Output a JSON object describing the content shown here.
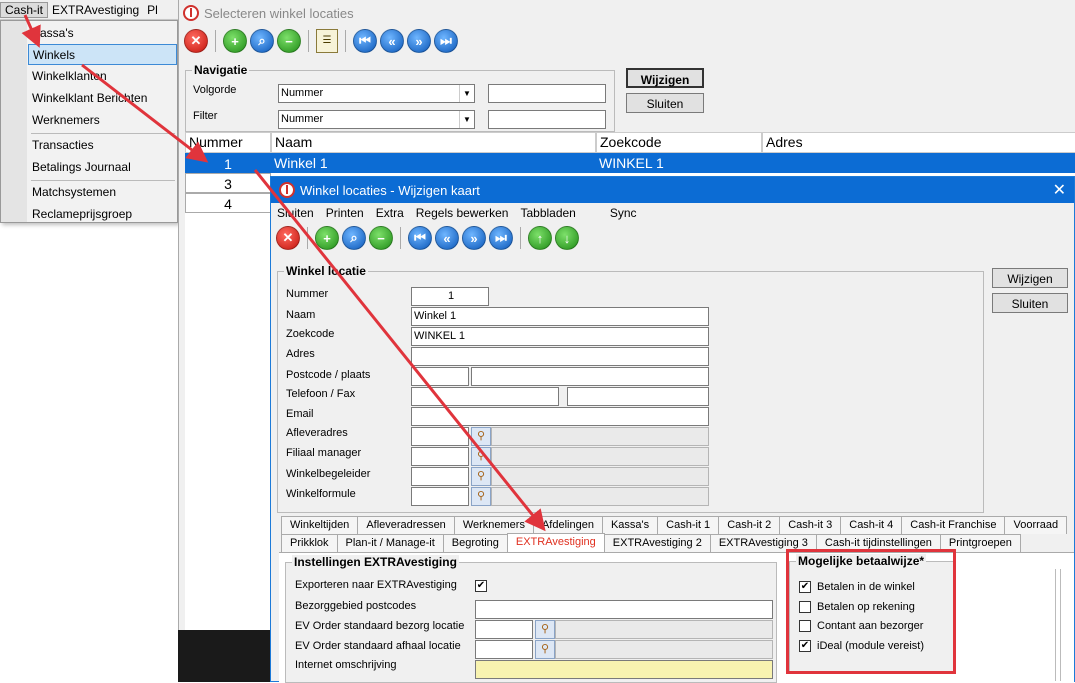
{
  "menubar": {
    "items": [
      "Cash-it",
      "EXTRAvestiging",
      "Pl"
    ]
  },
  "dropdown": {
    "items": [
      "Kassa's",
      "Winkels",
      "Winkelklanten",
      "Winkelklant Berichten",
      "Werknemers",
      "Transacties",
      "Betalings Journaal",
      "Matchsystemen",
      "Reclameprijsgroep"
    ]
  },
  "window1": {
    "title": "Selecteren winkel locaties",
    "nav_label": "Navigatie",
    "volgorde_label": "Volgorde",
    "filter_label": "Filter",
    "volgorde_value": "Nummer",
    "filter_value": "Nummer",
    "wijzigen": "Wijzigen",
    "sluiten": "Sluiten",
    "columns": [
      "Nummer",
      "Naam",
      "Zoekcode",
      "Adres"
    ],
    "rows": [
      {
        "nummer": "1",
        "naam": "Winkel 1",
        "zoekcode": "WINKEL 1",
        "adres": ""
      },
      {
        "nummer": "3",
        "naam": "",
        "zoekcode": "",
        "adres": ""
      },
      {
        "nummer": "4",
        "naam": "",
        "zoekcode": "",
        "adres": ""
      }
    ]
  },
  "window2": {
    "title": "Winkel locaties - Wijzigen kaart",
    "menu": [
      "Sluiten",
      "Printen",
      "Extra",
      "Regels bewerken",
      "Tabbladen",
      "Sync"
    ],
    "group_label": "Winkel locatie",
    "labels": {
      "nummer": "Nummer",
      "naam": "Naam",
      "zoekcode": "Zoekcode",
      "adres": "Adres",
      "postcode": "Postcode / plaats",
      "telefoon": "Telefoon / Fax",
      "email": "Email",
      "afleveradres": "Afleveradres",
      "filiaal": "Filiaal manager",
      "begeleider": "Winkelbegeleider",
      "formule": "Winkelformule"
    },
    "values": {
      "nummer": "1",
      "naam": "Winkel 1",
      "zoekcode": "WINKEL 1"
    },
    "wijzigen": "Wijzigen",
    "sluiten": "Sluiten",
    "tabs_row1": [
      "Winkeltijden",
      "Afleveradressen",
      "Werknemers",
      "Afdelingen",
      "Kassa's",
      "Cash-it 1",
      "Cash-it 2",
      "Cash-it 3",
      "Cash-it 4",
      "Cash-it Franchise",
      "Voorraad"
    ],
    "tabs_row2": [
      "Prikklok",
      "Plan-it / Manage-it",
      "Begroting",
      "EXTRAvestiging",
      "EXTRAvestiging 2",
      "EXTRAvestiging 3",
      "Cash-it tijdinstellingen",
      "Printgroepen"
    ],
    "settings": {
      "title": "Instellingen EXTRAvestiging",
      "exporteren": "Exporteren naar EXTRAvestiging",
      "bezorggebied": "Bezorggebied postcodes",
      "bezorg_locatie": "EV Order standaard bezorg locatie",
      "afhaal_locatie": "EV Order standaard afhaal locatie",
      "internet": "Internet omschrijving"
    },
    "payment": {
      "title": "Mogelijke betaalwijze*",
      "options": [
        {
          "label": "Betalen in de winkel",
          "checked": true
        },
        {
          "label": "Betalen op rekening",
          "checked": false
        },
        {
          "label": "Contant aan bezorger",
          "checked": false
        },
        {
          "label": "iDeal (module vereist)",
          "checked": true
        }
      ]
    }
  },
  "colors": {
    "selection": "#0c6cd4",
    "annotation": "#e0343c"
  }
}
